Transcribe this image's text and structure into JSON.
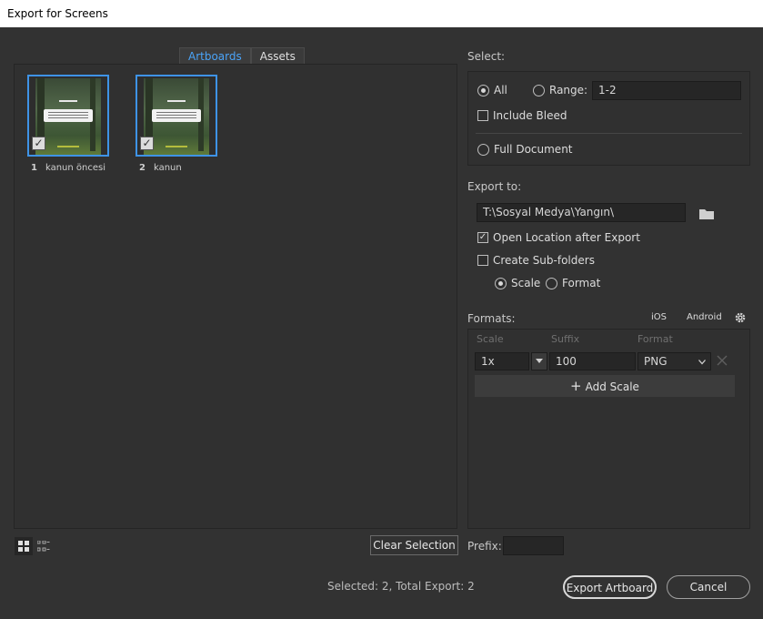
{
  "window": {
    "title": "Export for Screens"
  },
  "tabs": [
    {
      "label": "Artboards"
    },
    {
      "label": "Assets"
    }
  ],
  "artboards": [
    {
      "number": "1",
      "name": "kanun öncesi"
    },
    {
      "number": "2",
      "name": "kanun"
    }
  ],
  "select": {
    "label": "Select:",
    "all_label": "All",
    "range_label": "Range:",
    "range_value": "1-2",
    "include_bleed_label": "Include Bleed",
    "full_document_label": "Full Document"
  },
  "export_to": {
    "label": "Export to:",
    "path": "T:\\Sosyal Medya\\Yangın\\",
    "open_location_label": "Open Location after Export",
    "create_subfolders_label": "Create Sub-folders",
    "scale_label": "Scale",
    "format_label": "Format"
  },
  "formats": {
    "label": "Formats:",
    "ios_label": "iOS",
    "android_label": "Android",
    "col_scale": "Scale",
    "col_suffix": "Suffix",
    "col_format": "Format",
    "rows": [
      {
        "scale": "1x",
        "suffix": "100",
        "format": "PNG"
      }
    ],
    "add_scale_label": "Add Scale"
  },
  "prefix": {
    "label": "Prefix:",
    "value": ""
  },
  "bottom": {
    "clear_selection_label": "Clear Selection",
    "status": "Selected: 2, Total Export: 2",
    "export_label": "Export Artboard",
    "cancel_label": "Cancel"
  },
  "colors": {
    "accent": "#3e93e6",
    "tab_active_text": "#4aa3f7",
    "background": "#323232"
  }
}
